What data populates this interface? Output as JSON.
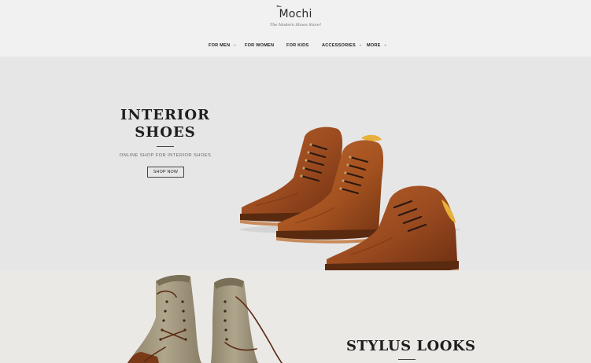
{
  "brand": {
    "name": "Mochi",
    "tagline": "The Modern Shoes Store!"
  },
  "nav": {
    "items": [
      {
        "label": "FOR MEN",
        "has_dropdown": true
      },
      {
        "label": "FOR WOMEN",
        "has_dropdown": false
      },
      {
        "label": "FOR KIDS",
        "has_dropdown": false
      },
      {
        "label": "ACCESSORIES",
        "has_dropdown": true
      },
      {
        "label": "MORE",
        "has_dropdown": true
      }
    ],
    "caret": "⌄"
  },
  "hero": {
    "title_line1": "INTERIOR",
    "title_line2": "SHOES",
    "subtitle": "ONLINE SHOP FOR INTERIOR SHOES",
    "button_label": "SHOP NOW",
    "image": "brown-leather-shoes-pair"
  },
  "section2": {
    "title": "STYLUS LOOKS",
    "image": "canvas-boots-pair"
  },
  "colors": {
    "header_bg": "#f1f1f1",
    "hero_bg": "#e6e6e6",
    "section2_bg": "#ebe9e6",
    "leather": "#9a4a1f",
    "canvas": "#a59a82"
  }
}
